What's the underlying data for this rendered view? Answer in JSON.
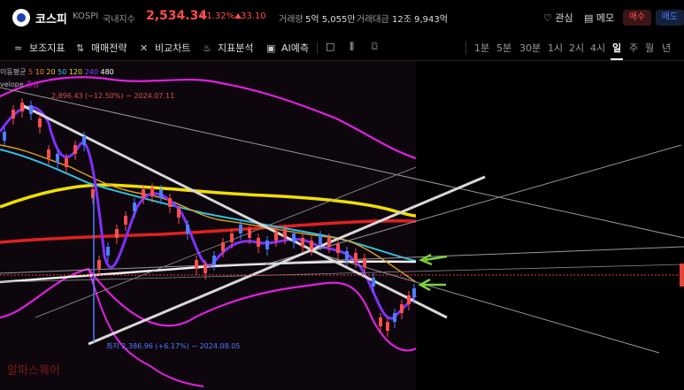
{
  "header": {
    "title": "코스피",
    "code": "KOSPI",
    "market": "국내지수",
    "price": "2,534.34",
    "change_pct": "+1.32%",
    "change": "33.10",
    "volume_label": "거래량",
    "volume": "5억 5,055만",
    "amount_label": "거래대금",
    "amount": "12조 9,943억",
    "favorite": "관심",
    "memo": "메모",
    "buy": "매수",
    "sell": "매도"
  },
  "toolbar": {
    "indicators": "보조지표",
    "strategy": "매매전략",
    "compare": "비교차트",
    "analysis": "지표분석",
    "ai": "AI예측",
    "timeframes": [
      "1분",
      "5분",
      "30분",
      "1시",
      "2시",
      "4시",
      "일",
      "주",
      "월",
      "년"
    ],
    "active_timeframe": "일"
  },
  "legend": {
    "ma_label": "이동평균",
    "ma_periods": [
      "5",
      "10",
      "20",
      "50",
      "120",
      "240",
      "480"
    ],
    "ma_colors": [
      "#e05050",
      "#e0a020",
      "#e0c030",
      "#30c0e0",
      "#e0e020",
      "#8040ff",
      "#ffffff"
    ],
    "envelope_label": "velope",
    "envelope_value": "중심",
    "high_label": "2,896.43 (−12.50%) − 2024.07.11",
    "low_label": "최저 2,386.96 (+6.17%) − 2024.08.05",
    "watermark": "알파스퀘어"
  },
  "colors": {
    "up": "#ff4d4f",
    "down": "#4d7dff",
    "ma120": "#f0e000",
    "ma240": "#e02020",
    "bollinger": "#e020e0",
    "white_line": "#f0f0f0",
    "arrow": "#80d040"
  }
}
